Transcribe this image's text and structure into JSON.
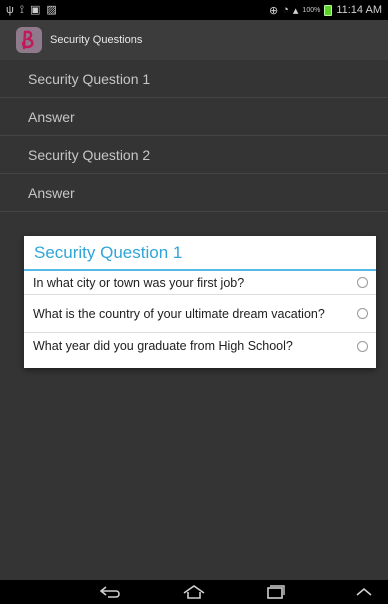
{
  "status_bar": {
    "left_icons": [
      "usb-icon",
      "notification-icon",
      "image-icon",
      "message-icon"
    ],
    "percent_text": "100%",
    "time": "11:14 AM"
  },
  "app_bar": {
    "title": "Security Questions"
  },
  "form": {
    "rows": [
      "Security Question 1",
      "Answer",
      "Security Question 2",
      "Answer"
    ]
  },
  "dialog": {
    "title": "Security Question 1",
    "options": [
      "In what city or town was your first job?",
      "What is the country of your ultimate dream vacation?",
      "What year did you graduate from High School?"
    ]
  },
  "colors": {
    "dialog_accent": "#2fa5d8",
    "battery": "#5dd12c"
  }
}
